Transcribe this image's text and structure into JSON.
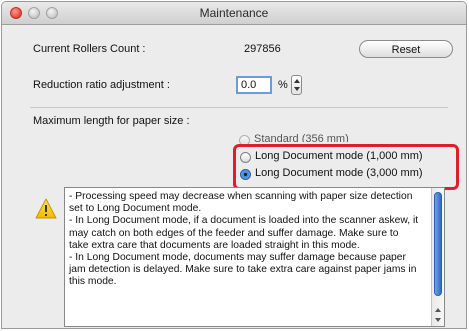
{
  "window": {
    "title": "Maintenance"
  },
  "rollers": {
    "label": "Current Rollers Count :",
    "value": "297856",
    "reset_label": "Reset"
  },
  "reduction": {
    "label": "Reduction ratio adjustment :",
    "value": "0.0",
    "unit": "%"
  },
  "paper": {
    "label": "Maximum length for paper size :",
    "options": [
      {
        "label": "Standard (356 mm)",
        "selected": false
      },
      {
        "label": "Long Document mode (1,000 mm)",
        "selected": false
      },
      {
        "label": "Long Document mode (3,000 mm)",
        "selected": true
      }
    ]
  },
  "notice": {
    "icon": "warning-icon",
    "text": "- Processing speed may decrease when scanning with paper size detection set to Long Document mode.\n- In Long Document mode, if a document is loaded into the scanner askew, it may catch on both edges of the feeder and suffer damage. Make sure to take extra care that documents are loaded straight in this mode.\n- In Long Document mode, documents may suffer damage because paper jam detection is delayed. Make sure to take extra care against paper jams in this mode."
  },
  "colors": {
    "highlight": "#dd1f2a",
    "accent": "#3f86d8",
    "close": "#e0443a"
  }
}
